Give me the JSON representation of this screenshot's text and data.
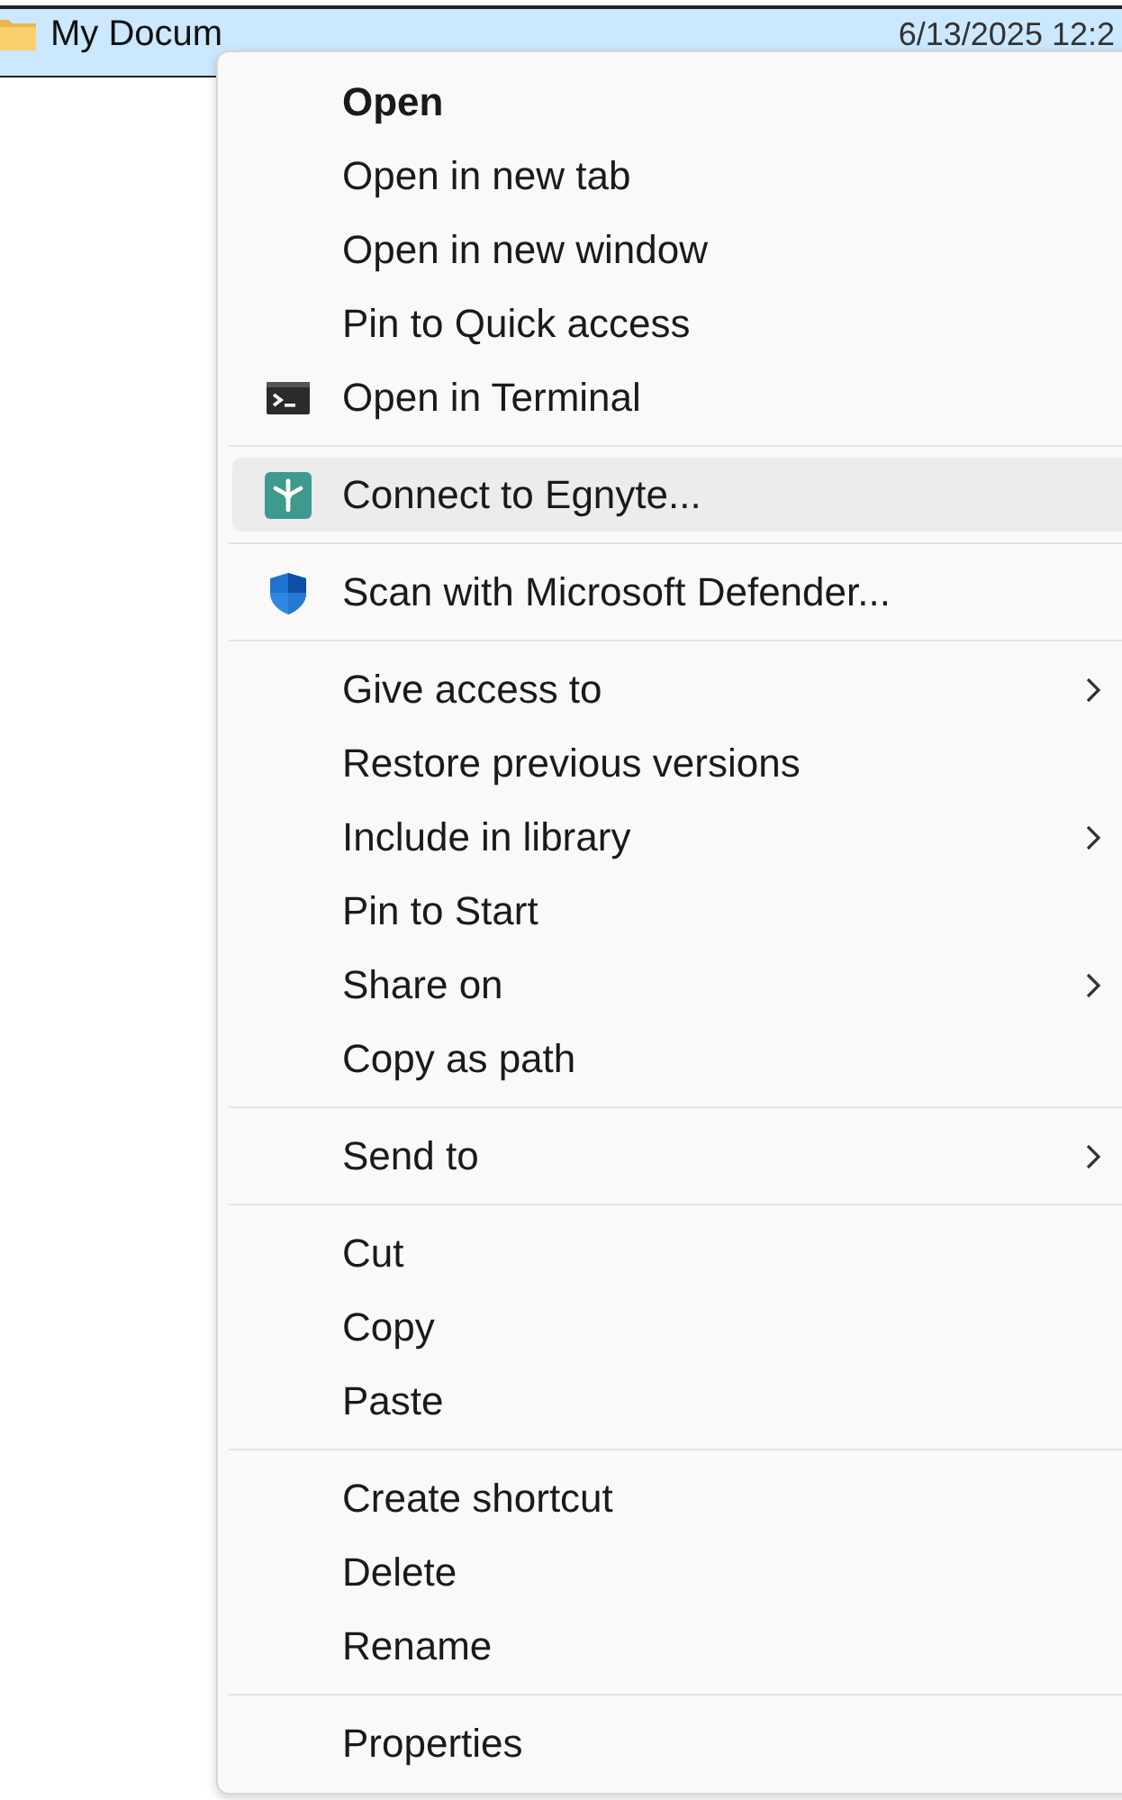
{
  "file_row": {
    "name": "My Docum",
    "modified": "6/13/2025 12:2",
    "selected": true
  },
  "context_menu": {
    "groups": [
      {
        "items": [
          {
            "label": "Open",
            "default": true,
            "kind": "plain",
            "submenu": false,
            "highlighted": false
          },
          {
            "label": "Open in new tab",
            "default": false,
            "kind": "plain",
            "submenu": false,
            "highlighted": false
          },
          {
            "label": "Open in new window",
            "default": false,
            "kind": "plain",
            "submenu": false,
            "highlighted": false
          },
          {
            "label": "Pin to Quick access",
            "default": false,
            "kind": "plain",
            "submenu": false,
            "highlighted": false
          },
          {
            "label": "Open in Terminal",
            "default": false,
            "kind": "terminal",
            "submenu": false,
            "highlighted": false
          }
        ]
      },
      {
        "items": [
          {
            "label": "Connect to Egnyte...",
            "default": false,
            "kind": "egnyte",
            "submenu": false,
            "highlighted": true
          }
        ]
      },
      {
        "items": [
          {
            "label": "Scan with Microsoft Defender...",
            "default": false,
            "kind": "defender",
            "submenu": false,
            "highlighted": false
          }
        ]
      },
      {
        "items": [
          {
            "label": "Give access to",
            "default": false,
            "kind": "plain",
            "submenu": true,
            "highlighted": false
          },
          {
            "label": "Restore previous versions",
            "default": false,
            "kind": "plain",
            "submenu": false,
            "highlighted": false
          },
          {
            "label": "Include in library",
            "default": false,
            "kind": "plain",
            "submenu": true,
            "highlighted": false
          },
          {
            "label": "Pin to Start",
            "default": false,
            "kind": "plain",
            "submenu": false,
            "highlighted": false
          },
          {
            "label": "Share on",
            "default": false,
            "kind": "plain",
            "submenu": true,
            "highlighted": false
          },
          {
            "label": "Copy as path",
            "default": false,
            "kind": "plain",
            "submenu": false,
            "highlighted": false
          }
        ]
      },
      {
        "items": [
          {
            "label": "Send to",
            "default": false,
            "kind": "plain",
            "submenu": true,
            "highlighted": false
          }
        ]
      },
      {
        "items": [
          {
            "label": "Cut",
            "default": false,
            "kind": "plain",
            "submenu": false,
            "highlighted": false
          },
          {
            "label": "Copy",
            "default": false,
            "kind": "plain",
            "submenu": false,
            "highlighted": false
          },
          {
            "label": "Paste",
            "default": false,
            "kind": "plain",
            "submenu": false,
            "highlighted": false
          }
        ]
      },
      {
        "items": [
          {
            "label": "Create shortcut",
            "default": false,
            "kind": "plain",
            "submenu": false,
            "highlighted": false
          },
          {
            "label": "Delete",
            "default": false,
            "kind": "plain",
            "submenu": false,
            "highlighted": false
          },
          {
            "label": "Rename",
            "default": false,
            "kind": "plain",
            "submenu": false,
            "highlighted": false
          }
        ]
      },
      {
        "items": [
          {
            "label": "Properties",
            "default": false,
            "kind": "plain",
            "submenu": false,
            "highlighted": false
          }
        ]
      }
    ]
  }
}
